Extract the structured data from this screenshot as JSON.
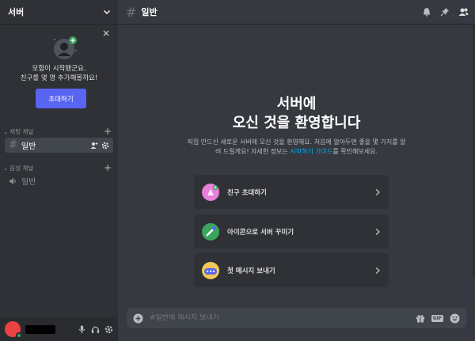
{
  "server": {
    "name": "서버"
  },
  "invite_card": {
    "text": "모험이 시작됐군요.\n친구를 몇 명 추가해볼까요!",
    "button_label": "초대하기"
  },
  "categories": {
    "text": {
      "label": "채팅 채널",
      "channel": "일반"
    },
    "voice": {
      "label": "음성 채널",
      "channel": "일반"
    }
  },
  "channel_header": {
    "title": "일반"
  },
  "welcome": {
    "title": "서버에\n오신 것을 환영합니다",
    "desc_before": "직접 만드신 새로운 서버에 오신 것을 환영해요. 처음에 알아두면 좋을 몇 가지를 알려    드릴게요! 자세한 정보는 ",
    "desc_link": "시작하기 가이드",
    "desc_after": "를 확인해보세요."
  },
  "actions": [
    {
      "label": "친구 초대하기",
      "icon": "invite-friend-icon",
      "color": "#e780d8"
    },
    {
      "label": "아이콘으로 서버 꾸미기",
      "icon": "customize-server-icon",
      "color": "#3ba55d"
    },
    {
      "label": "첫 메시지 보내기",
      "icon": "send-message-icon",
      "color": "#f0c957"
    }
  ],
  "composer": {
    "placeholder": "#일반에 메시지 보내기"
  },
  "colors": {
    "brand": "#5865f2",
    "link": "#00aff4"
  }
}
